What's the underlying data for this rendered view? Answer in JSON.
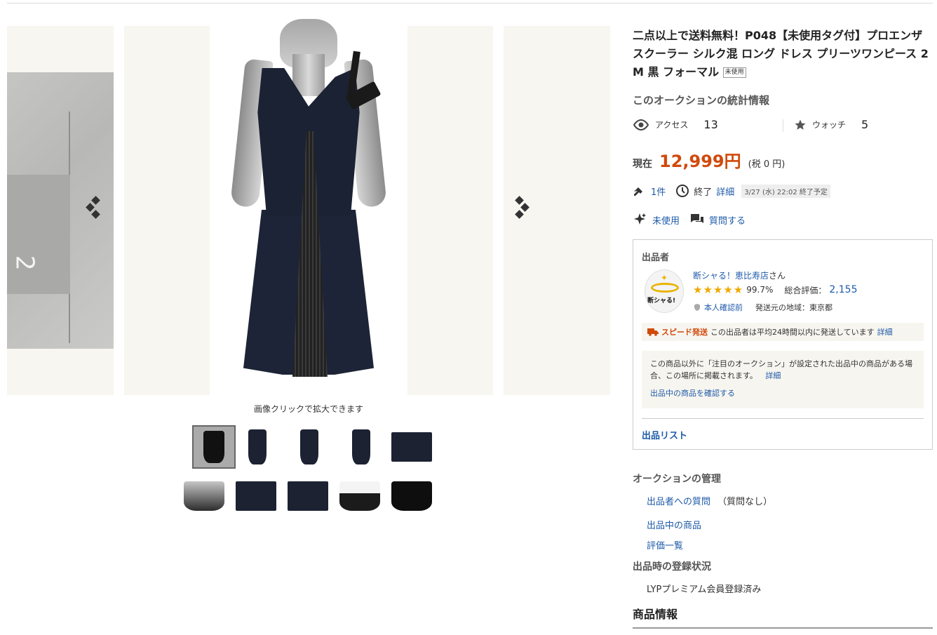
{
  "gallery": {
    "zoom_note": "画像クリックで拡大できます",
    "tag_number": "2"
  },
  "item": {
    "title": "二点以上で送料無料！P048【未使用タグ付】プロエンザ スクーラー シルク混 ロング ドレス プリーツワンピース 2 M 黒 フォーマル",
    "condition_badge": "未使用"
  },
  "stats": {
    "heading": "このオークションの統計情報",
    "access_label": "アクセス",
    "access_value": "13",
    "watch_label": "ウォッチ",
    "watch_value": "5"
  },
  "price": {
    "label": "現在",
    "value": "12,999円",
    "tax": "(税 0 円)"
  },
  "bid": {
    "count": "1件",
    "end_label": "終了",
    "detail_link": "詳細",
    "end_time": "3/27 (水) 22:02 終了予定"
  },
  "condition": {
    "value": "未使用",
    "question_link": "質問する"
  },
  "seller": {
    "heading": "出品者",
    "logo_text": "断シャる!",
    "name": "断シャる！恵比寿店",
    "name_suffix": "さん",
    "rating_pct": "99.7%",
    "total_label": "総合評価：",
    "total_value": "2,155",
    "verified": "本人確認前",
    "region": "発送元の地域：東京都",
    "speed_tag": "スピード発送",
    "speed_text": "この出品者は平均24時間以内に発送しています",
    "speed_detail": "詳細",
    "notice_text": "この商品以外に「注目のオークション」が設定された出品中の商品がある場合、この場所に掲載されます。",
    "notice_detail": "詳細",
    "notice_link": "出品中の商品を確認する",
    "list_link": "出品リスト"
  },
  "management": {
    "heading": "オークションの管理",
    "question_link": "出品者への質問",
    "question_status": "（質問なし）",
    "items_link": "出品中の商品",
    "reviews_link": "評価一覧"
  },
  "registration": {
    "heading": "出品時の登録状況",
    "status": "LYPプレミアム会員登録済み"
  },
  "product_info": {
    "heading": "商品情報"
  },
  "colors": {
    "price": "#d04a0c",
    "link": "#1e5aa8",
    "star": "#f0a800"
  }
}
